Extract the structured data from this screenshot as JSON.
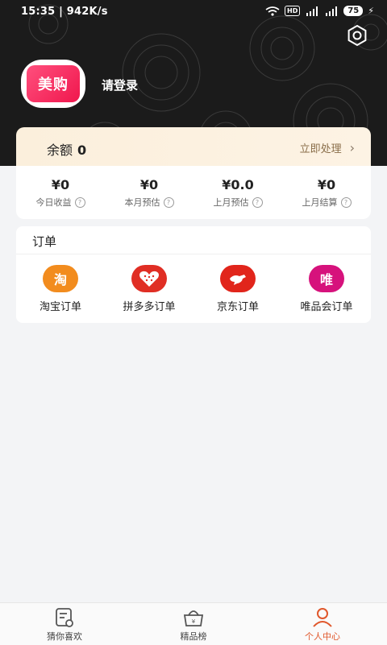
{
  "status_bar": {
    "time": "15:35 | 942K/s",
    "network": "4G",
    "hd": "HD",
    "battery": "75"
  },
  "header": {
    "avatar_text": "美购",
    "login_text": "请登录"
  },
  "balance": {
    "label": "余额",
    "value": "0",
    "action_label": "立即处理"
  },
  "stats": [
    {
      "value": "¥0",
      "label": "今日收益"
    },
    {
      "value": "¥0",
      "label": "本月预估"
    },
    {
      "value": "¥0.0",
      "label": "上月预估"
    },
    {
      "value": "¥0",
      "label": "上月结算"
    }
  ],
  "orders": {
    "title": "订单",
    "items": [
      {
        "label": "淘宝订单",
        "icon": "taobao-icon",
        "glyph": "淘",
        "color": "#f28c1e"
      },
      {
        "label": "拼多多订单",
        "icon": "pinduoduo-icon",
        "glyph": "",
        "color": "#e02e24"
      },
      {
        "label": "京东订单",
        "icon": "jd-icon",
        "glyph": "",
        "color": "#e1251b"
      },
      {
        "label": "唯品会订单",
        "icon": "vip-icon",
        "glyph": "唯",
        "color": "#d6127c"
      }
    ]
  },
  "bottom_nav": [
    {
      "label": "猜你喜欢",
      "icon": "list-icon",
      "active": false
    },
    {
      "label": "精品榜",
      "icon": "basket-icon",
      "active": false
    },
    {
      "label": "个人中心",
      "icon": "person-icon",
      "active": true
    }
  ],
  "colors": {
    "accent": "#e0572b",
    "header_bg": "#1b1b1b",
    "balance_bg": "#fbefdc"
  }
}
